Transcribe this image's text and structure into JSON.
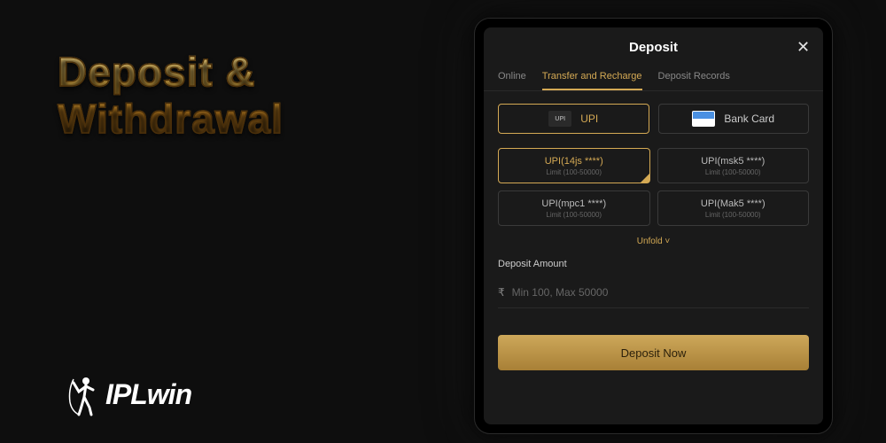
{
  "promo": {
    "title_line1": "Deposit &",
    "title_line2": "Withdrawal"
  },
  "brand": {
    "name": "IPLwin"
  },
  "screen": {
    "header": "Deposit",
    "close": "✕",
    "tabs": [
      {
        "label": "Online",
        "active": false
      },
      {
        "label": "Transfer and Recharge",
        "active": true
      },
      {
        "label": "Deposit Records",
        "active": false
      }
    ],
    "methods": [
      {
        "id": "upi",
        "label": "UPI",
        "icon": "UPI",
        "active": true
      },
      {
        "id": "bank",
        "label": "Bank Card",
        "icon": "",
        "active": false
      }
    ],
    "accounts": [
      {
        "name": "UPI(14js ****)",
        "limit": "Limit (100-50000)",
        "active": true
      },
      {
        "name": "UPI(msk5 ****)",
        "limit": "Limit (100-50000)",
        "active": false
      },
      {
        "name": "UPI(mpc1 ****)",
        "limit": "Limit (100-50000)",
        "active": false
      },
      {
        "name": "UPI(Mak5 ****)",
        "limit": "Limit (100-50000)",
        "active": false
      }
    ],
    "unfold": "Unfold",
    "amount": {
      "label": "Deposit Amount",
      "currency": "₹",
      "placeholder": "Min 100, Max 50000"
    },
    "button": "Deposit Now"
  }
}
